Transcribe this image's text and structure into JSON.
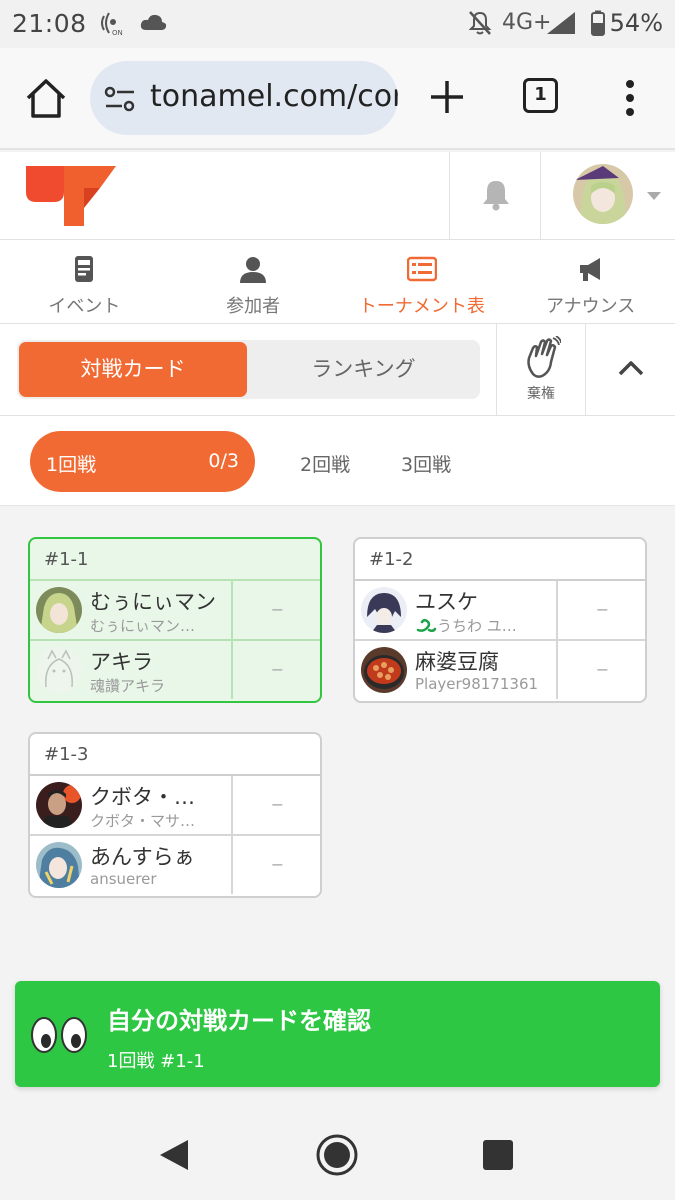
{
  "status_bar": {
    "time": "21:08",
    "network": "4G+",
    "battery": "54%",
    "icons": [
      "nfc-icon",
      "cloud-icon",
      "notifications-off-icon",
      "signal-icon",
      "battery-icon"
    ]
  },
  "browser": {
    "url": "tonamel.com/cor",
    "tab_count": "1",
    "icons": [
      "home-icon",
      "site-settings-icon",
      "new-tab-icon",
      "tab-switcher-icon",
      "more-menu-icon"
    ]
  },
  "header": {
    "logo_icon": "tonamel-logo-icon",
    "bell_icon": "bell-icon",
    "avatar_icon": "user-avatar",
    "accent": "#f26a33"
  },
  "nav_tabs": [
    {
      "label": "イベント",
      "icon": "event-document-icon",
      "active": false
    },
    {
      "label": "参加者",
      "icon": "person-icon",
      "active": false
    },
    {
      "label": "トーナメント表",
      "icon": "bracket-list-icon",
      "active": true
    },
    {
      "label": "アナウンス",
      "icon": "megaphone-icon",
      "active": false
    }
  ],
  "toolbar": {
    "segment_active": "対戦カード",
    "segment_inactive": "ランキング",
    "forfeit_label": "棄権",
    "forfeit_icon": "waving-hand-icon",
    "collapse_icon": "chevron-up-icon"
  },
  "rounds": {
    "active": {
      "name": "1回戦",
      "count": "0/3"
    },
    "others": [
      "2回戦",
      "3回戦"
    ]
  },
  "matches": [
    {
      "id": "#1-1",
      "mine": true,
      "players": [
        {
          "name": "むぅにぃマン",
          "sub": "むぅにぃマン…",
          "score": "−"
        },
        {
          "name": "アキラ",
          "sub": "魂讚アキラ",
          "score": "−"
        }
      ]
    },
    {
      "id": "#1-2",
      "mine": false,
      "players": [
        {
          "name": "ユスケ",
          "sub": "うちわ ユ…",
          "score": "−"
        },
        {
          "name": "麻婆豆腐",
          "sub": "Player98171361",
          "score": "−"
        }
      ]
    },
    {
      "id": "#1-3",
      "mine": false,
      "players": [
        {
          "name": "クボタ・…",
          "sub": "クボタ・マサ…",
          "score": "−"
        },
        {
          "name": "あんすらぁ",
          "sub": "ansuerer",
          "score": "−"
        }
      ]
    }
  ],
  "banner": {
    "title": "自分の対戦カードを確認",
    "subtitle": "1回戦 #1-1",
    "icon": "eyes-icon",
    "color": "#2dc743"
  },
  "system_nav": [
    "back-icon",
    "home-circle-icon",
    "recents-icon"
  ]
}
